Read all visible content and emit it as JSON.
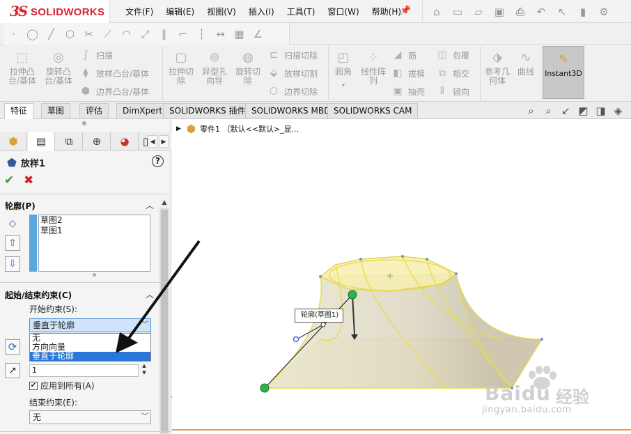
{
  "app": {
    "logo_mark": "3S",
    "logo_text": "SOLIDWORKS"
  },
  "menu": [
    "文件(F)",
    "编辑(E)",
    "视图(V)",
    "插入(I)",
    "工具(T)",
    "窗口(W)",
    "帮助(H)"
  ],
  "ribbon": {
    "extrude_boss": "拉伸凸台/基体",
    "revolve_boss": "旋转凸台/基体",
    "sweep": "扫描",
    "loft_boss": "放样凸台/基体",
    "boundary_boss": "边界凸台/基体",
    "extrude_cut": "拉伸切除",
    "hole_wizard": "异型孔向导",
    "revolve_cut": "旋转切除",
    "swept_cut": "扫描切除",
    "loft_cut": "放样切割",
    "boundary_cut": "边界切除",
    "fillet": "圆角",
    "linear_pattern": "线性阵列",
    "rib": "筋",
    "draft": "拔模",
    "shell": "抽壳",
    "wrap": "包覆",
    "intersect": "相交",
    "mirror": "镜向",
    "reference_geometry": "参考几何体",
    "curves": "曲线",
    "instant3d": "Instant3D"
  },
  "tabs": [
    "特征",
    "草图",
    "评估",
    "DimXpert",
    "SOLIDWORKS 插件",
    "SOLIDWORKS MBD",
    "SOLIDWORKS CAM"
  ],
  "property_manager": {
    "title": "放样1",
    "help": "?",
    "profiles": {
      "title": "轮廓(P)",
      "items": [
        "草图2",
        "草图1"
      ]
    },
    "constraints": {
      "title": "起始/结束约束(C)",
      "start_label": "开始约束(S):",
      "start_value": "垂直于轮廓",
      "options": [
        "无",
        "方向向量",
        "垂直于轮廓"
      ],
      "tangent_length": "1",
      "apply_all": "应用到所有(A)",
      "end_label": "结束约束(E):",
      "end_value": "无"
    }
  },
  "tree": {
    "text": "零件1 （默认<<默认>_显..."
  },
  "graphics": {
    "callout": "轮廓(草图1)"
  },
  "watermark": {
    "brand": "Baidu",
    "cn": "经验",
    "url": "jingyan.baidu.com"
  }
}
